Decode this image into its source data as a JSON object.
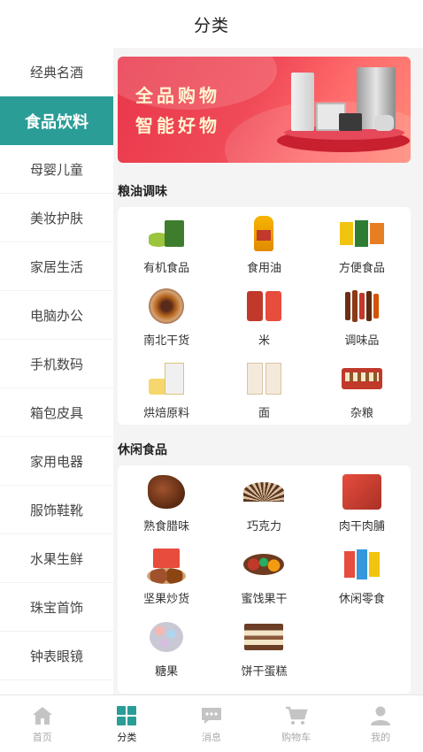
{
  "header": {
    "title": "分类"
  },
  "sidebar": {
    "items": [
      {
        "label": "经典名酒"
      },
      {
        "label": "食品饮料",
        "active": true
      },
      {
        "label": "母婴儿童"
      },
      {
        "label": "美妆护肤"
      },
      {
        "label": "家居生活"
      },
      {
        "label": "电脑办公"
      },
      {
        "label": "手机数码"
      },
      {
        "label": "箱包皮具"
      },
      {
        "label": "家用电器"
      },
      {
        "label": "服饰鞋靴"
      },
      {
        "label": "水果生鲜"
      },
      {
        "label": "珠宝首饰"
      },
      {
        "label": "钟表眼镜"
      }
    ]
  },
  "banner": {
    "line1": "全品购物",
    "line2": "智能好物"
  },
  "sections": [
    {
      "title": "粮油调味",
      "items": [
        {
          "label": "有机食品",
          "icon": "organic-food-icon"
        },
        {
          "label": "食用油",
          "icon": "cooking-oil-icon"
        },
        {
          "label": "方便食品",
          "icon": "instant-food-icon"
        },
        {
          "label": "南北干货",
          "icon": "dried-goods-icon"
        },
        {
          "label": "米",
          "icon": "rice-icon"
        },
        {
          "label": "调味品",
          "icon": "condiments-icon"
        },
        {
          "label": "烘焙原料",
          "icon": "baking-icon"
        },
        {
          "label": "面",
          "icon": "flour-icon"
        },
        {
          "label": "杂粮",
          "icon": "grains-icon"
        }
      ]
    },
    {
      "title": "休闲食品",
      "items": [
        {
          "label": "熟食腊味",
          "icon": "cured-meat-icon"
        },
        {
          "label": "巧克力",
          "icon": "chocolate-icon"
        },
        {
          "label": "肉干肉脯",
          "icon": "jerky-icon"
        },
        {
          "label": "坚果炒货",
          "icon": "nuts-icon"
        },
        {
          "label": "蜜饯果干",
          "icon": "dried-fruit-icon"
        },
        {
          "label": "休闲零食",
          "icon": "snacks-icon"
        },
        {
          "label": "糖果",
          "icon": "candy-icon"
        },
        {
          "label": "饼干蛋糕",
          "icon": "cake-icon"
        }
      ]
    }
  ],
  "tabbar": {
    "items": [
      {
        "label": "首页",
        "icon": "home-icon"
      },
      {
        "label": "分类",
        "icon": "category-icon",
        "active": true
      },
      {
        "label": "消息",
        "icon": "message-icon"
      },
      {
        "label": "购物车",
        "icon": "cart-icon"
      },
      {
        "label": "我的",
        "icon": "user-icon"
      }
    ]
  },
  "colors": {
    "accent": "#2a9d96",
    "banner": "#e8364a"
  }
}
